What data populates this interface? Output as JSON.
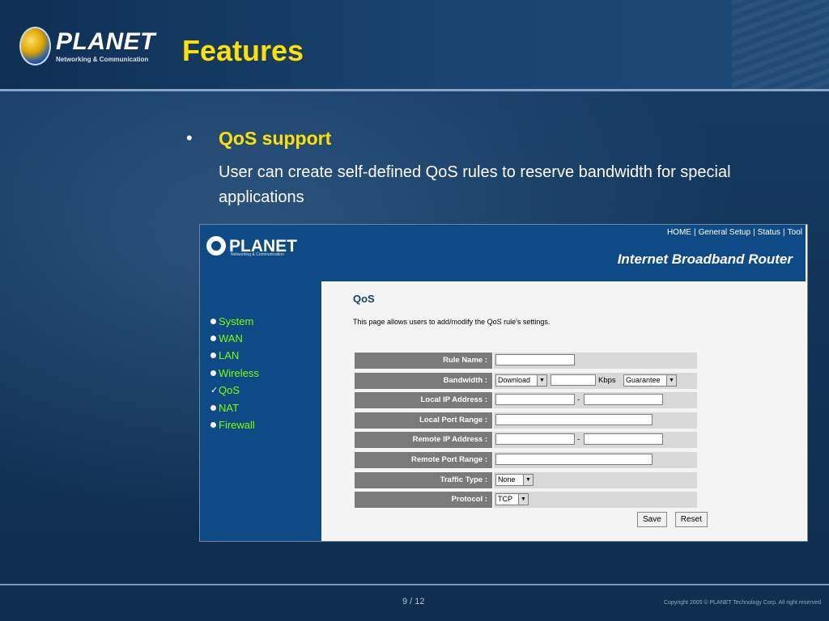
{
  "slide": {
    "title": "Features",
    "logo": {
      "name": "PLANET",
      "tagline": "Networking & Communication"
    },
    "bullet": {
      "heading": "QoS support",
      "body": "User can create self-defined QoS rules to reserve bandwidth for special applications"
    },
    "page_number": "9 / 12",
    "copyright": "Copyright 2005 © PLANET Technology Corp. All right reserved"
  },
  "router": {
    "logo": {
      "name": "PLANET",
      "tagline": "Networking & Communication"
    },
    "nav": {
      "home": "HOME",
      "general_setup": "General Setup",
      "status": "Status",
      "tool": "Tool"
    },
    "product_name": "Internet Broadband Router",
    "sidebar": [
      {
        "label": "System",
        "icon": "bullet-dot"
      },
      {
        "label": "WAN",
        "icon": "bullet-dot"
      },
      {
        "label": "LAN",
        "icon": "bullet-dot"
      },
      {
        "label": "Wireless",
        "icon": "bullet-dot"
      },
      {
        "label": "QoS",
        "icon": "checkmark"
      },
      {
        "label": "NAT",
        "icon": "bullet-dot"
      },
      {
        "label": "Firewall",
        "icon": "bullet-dot"
      }
    ],
    "page": {
      "title": "QoS",
      "description": "This page allows users to add/modify the QoS rule's settings."
    },
    "form": {
      "rule_name": {
        "label": "Rule Name :",
        "value": ""
      },
      "bandwidth": {
        "label": "Bandwidth :",
        "direction": "Download",
        "value": "",
        "unit": "Kbps",
        "mode": "Guarantee"
      },
      "local_ip": {
        "label": "Local IP Address :",
        "from": "",
        "separator": "-",
        "to": ""
      },
      "local_port": {
        "label": "Local Port Range :",
        "value": ""
      },
      "remote_ip": {
        "label": "Remote IP Address :",
        "from": "",
        "separator": "-",
        "to": ""
      },
      "remote_port": {
        "label": "Remote Port Range :",
        "value": ""
      },
      "traffic_type": {
        "label": "Traffic Type :",
        "value": "None"
      },
      "protocol": {
        "label": "Protocol :",
        "value": "TCP"
      }
    },
    "buttons": {
      "save": "Save",
      "reset": "Reset"
    }
  }
}
